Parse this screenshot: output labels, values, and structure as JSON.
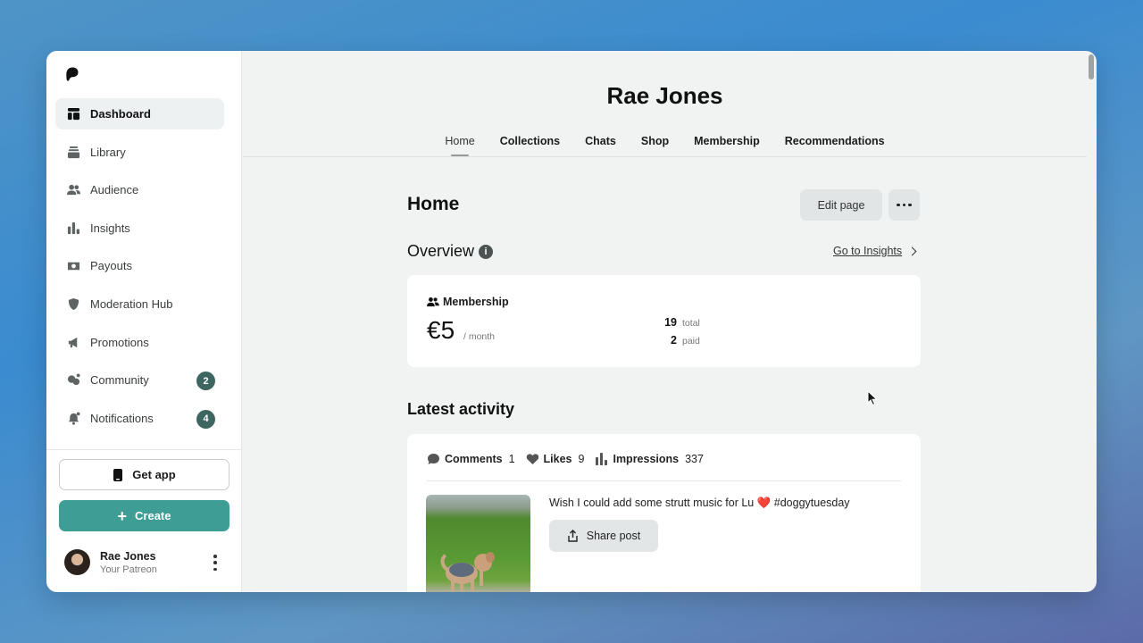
{
  "sidebar": {
    "items": [
      {
        "label": "Dashboard",
        "icon": "dashboard-icon"
      },
      {
        "label": "Library",
        "icon": "library-icon"
      },
      {
        "label": "Audience",
        "icon": "audience-icon"
      },
      {
        "label": "Insights",
        "icon": "insights-icon"
      },
      {
        "label": "Payouts",
        "icon": "payouts-icon"
      },
      {
        "label": "Moderation Hub",
        "icon": "shield-icon"
      },
      {
        "label": "Promotions",
        "icon": "megaphone-icon"
      },
      {
        "label": "Community",
        "icon": "chat-bubbles-icon",
        "badge": "2"
      },
      {
        "label": "Notifications",
        "icon": "bell-icon",
        "badge": "4"
      }
    ],
    "get_app_label": "Get app",
    "create_label": "Create",
    "user": {
      "name": "Rae Jones",
      "subtitle": "Your Patreon"
    }
  },
  "header": {
    "creator_name": "Rae Jones",
    "tabs": [
      "Home",
      "Collections",
      "Chats",
      "Shop",
      "Membership",
      "Recommendations"
    ]
  },
  "main": {
    "title": "Home",
    "edit_page_label": "Edit page",
    "overview": {
      "title": "Overview",
      "insights_link": "Go to Insights",
      "membership_label": "Membership",
      "price": "€5",
      "period": "/ month",
      "total_value": "19",
      "total_label": "total",
      "paid_value": "2",
      "paid_label": "paid"
    },
    "activity": {
      "title": "Latest activity",
      "comments_label": "Comments",
      "comments_count": "1",
      "likes_label": "Likes",
      "likes_count": "9",
      "impressions_label": "Impressions",
      "impressions_count": "337",
      "post_text": "Wish I could add some strutt music for Lu ❤️ #doggytuesday",
      "share_label": "Share post"
    }
  },
  "colors": {
    "accent": "#3e9e95",
    "badge": "#3e6660"
  }
}
